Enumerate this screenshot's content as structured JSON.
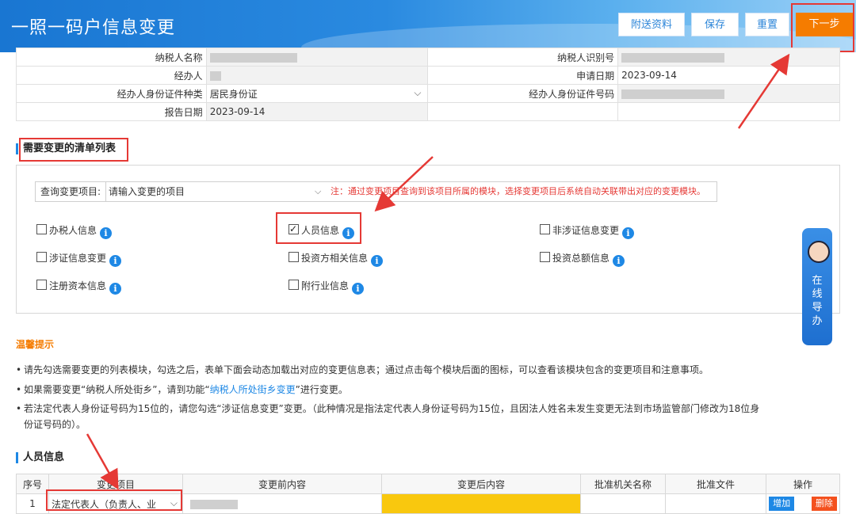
{
  "header": {
    "title": "一照一码户信息变更",
    "buttons": {
      "attach": "附送资料",
      "save": "保存",
      "reset": "重置",
      "next": "下一步"
    }
  },
  "info": {
    "taxpayer_name_label": "纳税人名称",
    "taxpayer_id_label": "纳税人识别号",
    "handler_label": "经办人",
    "apply_date_label": "申请日期",
    "apply_date": "2023-09-14",
    "id_type_label": "经办人身份证件种类",
    "id_type": "居民身份证",
    "id_no_label": "经办人身份证件号码",
    "report_date_label": "报告日期",
    "report_date": "2023-09-14"
  },
  "change_list": {
    "title": "需要变更的清单列表",
    "query_label": "查询变更项目:",
    "query_placeholder": "请输入变更的项目",
    "query_note": "注：通过变更项目查询到该项目所属的模块，选择变更项目后系统自动关联带出对应的变更模块。",
    "items": [
      {
        "label": "办税人信息",
        "checked": false
      },
      {
        "label": "人员信息",
        "checked": true
      },
      {
        "label": "非涉证信息变更",
        "checked": false
      },
      {
        "label": "涉证信息变更",
        "checked": false
      },
      {
        "label": "投资方相关信息",
        "checked": false
      },
      {
        "label": "投资总额信息",
        "checked": false
      },
      {
        "label": "注册资本信息",
        "checked": false
      },
      {
        "label": "附行业信息",
        "checked": false
      }
    ]
  },
  "side_widget": {
    "label_chars": [
      "在",
      "线",
      "导",
      "办"
    ]
  },
  "tips": {
    "title": "温馨提示",
    "line1": "请先勾选需要变更的列表模块，勾选之后，表单下面会动态加载出对应的变更信息表；通过点击每个模块后面的图标，可以查看该模块包含的变更项目和注意事项。",
    "line2_pre": "如果需要变更“纳税人所处街乡”，请到功能“",
    "line2_link": "纳税人所处街乡变更",
    "line2_post": "”进行变更。",
    "line3a": "若法定代表人身份证号码为15位的，请您勾选“涉证信息变更”变更。（此种情况是指法定代表人身份证号码为15位，且因法人姓名未发生变更无法到市场监管部门修改为18位身",
    "line3b": "份证号码的）。"
  },
  "personnel": {
    "title": "人员信息",
    "headers": [
      "序号",
      "变更项目",
      "变更前内容",
      "变更后内容",
      "批准机关名称",
      "批准文件",
      "操作"
    ],
    "row": {
      "index": "1",
      "item": "法定代表人（负责人、业",
      "add": "增加",
      "delete": "删除"
    }
  },
  "colors": {
    "accent": "#1e88e5",
    "next": "#f57c00",
    "highlight": "#e53935",
    "after_cell": "#f9c80e"
  }
}
